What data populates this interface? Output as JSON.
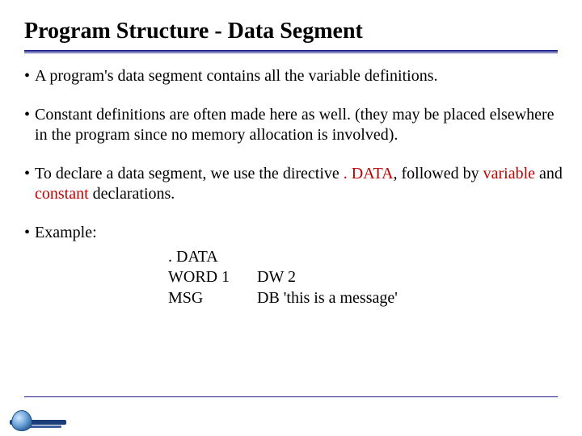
{
  "title": "Program Structure - Data Segment",
  "bullets": [
    {
      "parts": [
        {
          "t": "A program's data segment contains all the variable definitions."
        }
      ]
    },
    {
      "parts": [
        {
          "t": "Constant definitions are often made here as well. (they may be placed elsewhere in the program since no memory allocation is involved)."
        }
      ]
    },
    {
      "parts": [
        {
          "t": "To declare a data segment, we use the directive "
        },
        {
          "t": ". DATA",
          "red": true
        },
        {
          "t": ", followed by "
        },
        {
          "t": "variable",
          "red": true
        },
        {
          "t": " and "
        },
        {
          "t": "constant",
          "red": true
        },
        {
          "t": " declarations."
        }
      ]
    },
    {
      "parts": [
        {
          "t": "Example:"
        }
      ]
    }
  ],
  "code": {
    "line1_c1": ". DATA",
    "line2_c1": "WORD 1",
    "line2_c2": "DW 2",
    "line3_c1": "MSG",
    "line3_c2": "DB 'this is a message'"
  }
}
